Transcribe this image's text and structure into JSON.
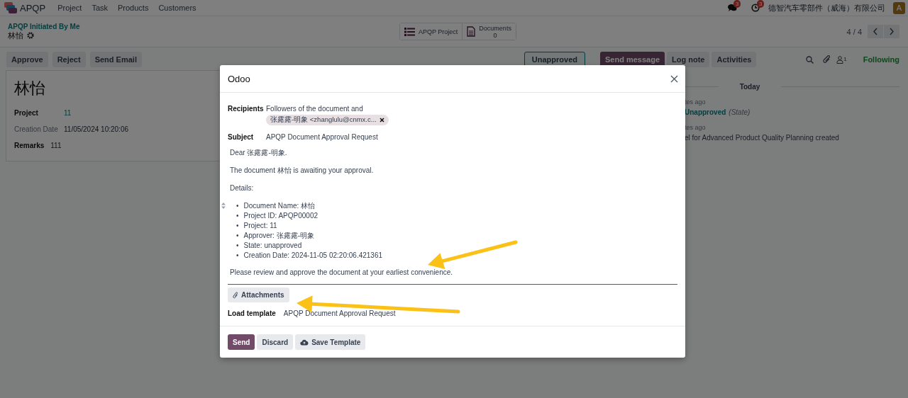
{
  "navbar": {
    "app_name": "APQP",
    "menu": [
      "Project",
      "Task",
      "Products",
      "Customers"
    ],
    "messages_badge": "3",
    "activities_badge": "3",
    "company": "德智汽车零部件（威海）有限公司",
    "avatar_letter": "A"
  },
  "control_panel": {
    "breadcrumb": "APQP Initiated By Me",
    "record_name": "林怡",
    "smart_buttons": [
      {
        "kind": "list",
        "label": "APQP Project"
      },
      {
        "kind": "document",
        "label": "Documents",
        "count": "0"
      }
    ],
    "pager": "4 / 4"
  },
  "action_buttons": [
    "Approve",
    "Reject",
    "Send Email"
  ],
  "status": [
    {
      "label": "Unapproved",
      "selected": true
    }
  ],
  "form": {
    "title": "林怡",
    "fields": [
      {
        "kind": "link",
        "label": "Project",
        "value": "11"
      },
      {
        "kind": "readonly",
        "label": "Creation Date",
        "value": "11/05/2024 10:20:06"
      },
      {
        "kind": "note",
        "label": "Remarks",
        "value": "111"
      }
    ]
  },
  "chatter": {
    "tabs": [
      {
        "label": "Send message",
        "selected": true
      },
      {
        "label": "Log note",
        "selected": false
      },
      {
        "label": "Activities",
        "selected": false
      }
    ],
    "followers_count": "1",
    "follow_status": "Following",
    "date_separator": "Today",
    "messages": [
      {
        "time": "tes ago",
        "value": "Unapproved",
        "field": "(State)"
      },
      {
        "time": "tes ago",
        "body": "el for Advanced Product Quality Planning created"
      }
    ]
  },
  "dialog": {
    "title": "Odoo",
    "recipients": {
      "label": "Recipients",
      "text": "Followers of the document and",
      "tags": [
        "张露露-明象 <zhanglulu@cnmx.c..."
      ]
    },
    "subject": {
      "label": "Subject",
      "value": "APQP Document Approval Request"
    },
    "body": [
      {
        "kind": "paragraph",
        "text": "Dear 张露露-明象."
      },
      {
        "kind": "paragraph",
        "text": "The document 林怡 is awaiting your approval."
      },
      {
        "kind": "paragraph",
        "text": "Details:"
      },
      {
        "kind": "list",
        "marker": "•",
        "items": [
          "Document Name: 林怡",
          "Project ID: APQP00002",
          "Project: 11",
          "Approver: 张露露-明象",
          "State: unapproved",
          "Creation Date: 2024-11-05 02:20:06.421361"
        ]
      },
      {
        "kind": "paragraph",
        "text": "Please review and approve the document at your earliest convenience."
      }
    ],
    "attachments_button": "Attachments",
    "load_template": {
      "label": "Load template",
      "value": "APQP Document Approval Request"
    },
    "footer_buttons": [
      {
        "kind": "primary",
        "label": "Send"
      },
      {
        "kind": "secondary",
        "label": "Discard"
      },
      {
        "kind": "save_template",
        "label": "Save Template"
      }
    ]
  }
}
